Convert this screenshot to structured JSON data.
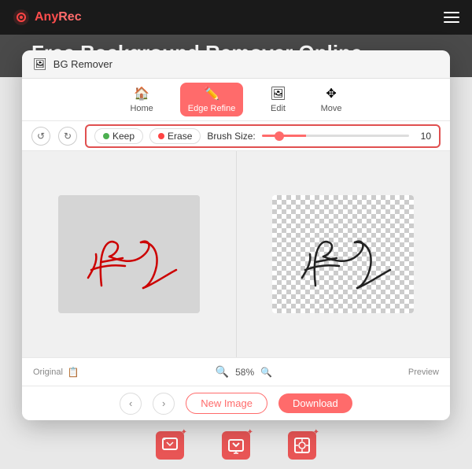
{
  "nav": {
    "logo_name": "Any",
    "logo_accent": "Rec",
    "hamburger_label": "menu"
  },
  "page": {
    "headline": "Free Background Remover Online"
  },
  "modal": {
    "header_title": "BG Remover",
    "tabs": [
      {
        "id": "home",
        "label": "Home",
        "active": false
      },
      {
        "id": "edge-refine",
        "label": "Edge Refine",
        "active": true
      },
      {
        "id": "edit",
        "label": "Edit",
        "active": false
      },
      {
        "id": "move",
        "label": "Move",
        "active": false
      }
    ],
    "brush": {
      "keep_label": "Keep",
      "erase_label": "Erase",
      "size_label": "Brush Size:",
      "size_value": "10"
    },
    "footer": {
      "original_label": "Original",
      "zoom_value": "58%",
      "preview_label": "Preview"
    },
    "actions": {
      "new_image_label": "New Image",
      "download_label": "Download"
    }
  }
}
